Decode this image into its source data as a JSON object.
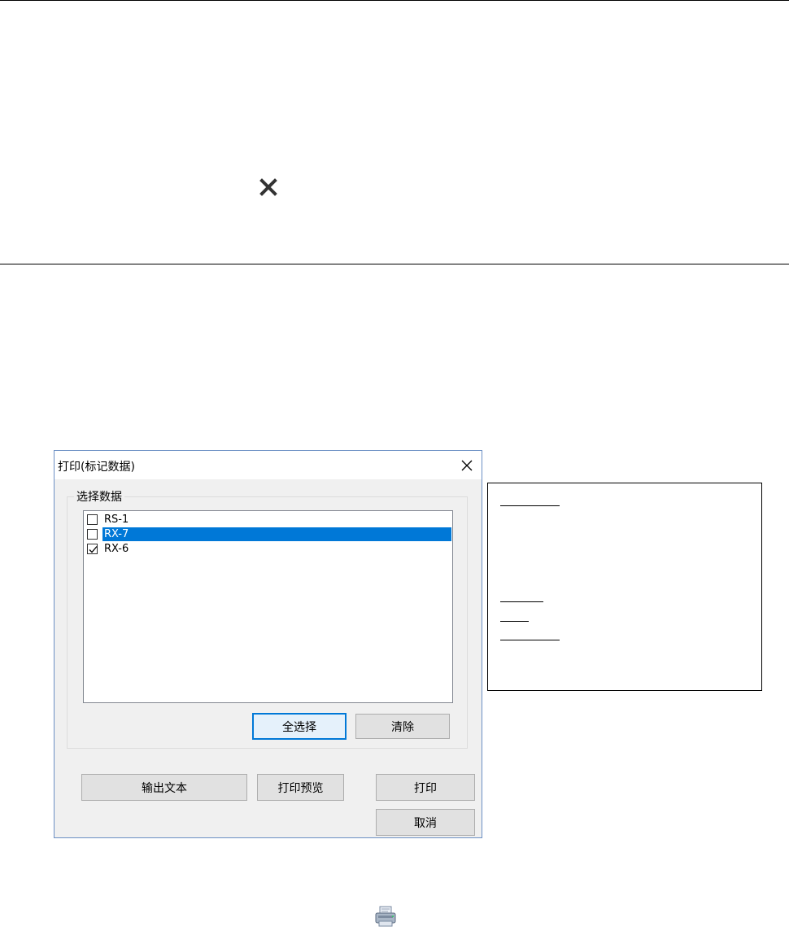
{
  "dialog": {
    "title": "打印(标记数据)",
    "group_label": "选择数据",
    "items": [
      {
        "label": "RS-1",
        "checked": false,
        "selected": false
      },
      {
        "label": "RX-7",
        "checked": false,
        "selected": true
      },
      {
        "label": "RX-6",
        "checked": true,
        "selected": false
      }
    ],
    "buttons": {
      "select_all": "全选择",
      "clear": "清除",
      "output_text": "输出文本",
      "print_preview": "打印预览",
      "print": "打印",
      "cancel": "取消"
    }
  },
  "icons": {
    "top_x": "close-x-icon",
    "dialog_close": "close-icon",
    "bottom": "printer-icon"
  },
  "colors": {
    "selection": "#0078d7",
    "dialog_border": "#6b8fc4"
  }
}
